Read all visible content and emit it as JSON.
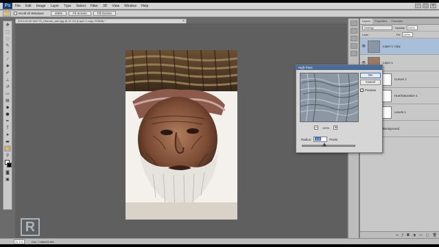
{
  "app": {
    "logo": "Ps"
  },
  "menu": [
    "File",
    "Edit",
    "Image",
    "Layer",
    "Type",
    "Select",
    "Filter",
    "3D",
    "View",
    "Window",
    "Help"
  ],
  "window_controls": [
    "–",
    "□",
    "×"
  ],
  "options": {
    "scroll_all_label": "Scroll All Windows",
    "btn_100": "100%",
    "btn_fit": "Fit Screen",
    "btn_fill": "Fill Screen"
  },
  "document": {
    "tab_title": "2013-09-30 W&T70_Oldman_web.jpg @ 31.1% (Layer 1 copy, RGB/8) *",
    "close": "×",
    "progress": 0.311
  },
  "layers_panel": {
    "tabs": [
      "Layers",
      "Properties",
      "Channels"
    ],
    "blend_mode": "Overlay",
    "opacity_label": "Opacity:",
    "opacity_value": "100%",
    "lock_label": "Lock:",
    "fill_label": "Fill:",
    "fill_value": "100%",
    "layers": [
      {
        "name": "Layer 1 copy",
        "selected": true
      },
      {
        "name": "Layer 1",
        "selected": false
      },
      {
        "name": "Curves 1",
        "selected": false
      },
      {
        "name": "Hue/Saturation 1",
        "selected": false
      },
      {
        "name": "Levels 1",
        "selected": false
      },
      {
        "name": "Background",
        "selected": false
      }
    ]
  },
  "high_pass": {
    "title": "High Pass",
    "ok": "OK",
    "cancel": "Cancel",
    "preview_label": "Preview",
    "preview_checked": "✓",
    "zoom_minus": "−",
    "zoom_value": "100%",
    "zoom_plus": "+",
    "radius_label": "Radius:",
    "radius_value": "4.3",
    "units": "Pixels"
  },
  "status": {
    "zoom": "31.1%",
    "doc_info": "Doc: 7.68M/22.8M"
  },
  "watermark": "R",
  "colors": {
    "accent": "#3167c4",
    "workspace": "#6b6b6b",
    "panel": "#c8c8c8"
  }
}
